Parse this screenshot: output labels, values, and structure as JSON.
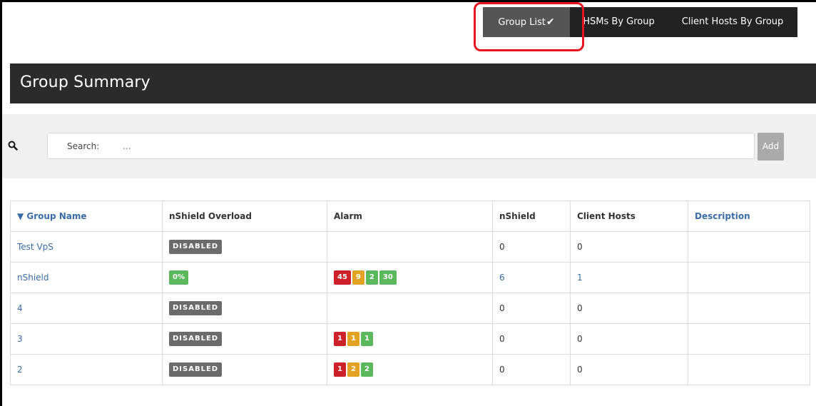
{
  "tabs": [
    {
      "label": "Group List",
      "active": true
    },
    {
      "label": "HSMs By Group"
    },
    {
      "label": "Client Hosts By Group"
    }
  ],
  "icons": {
    "active_tab_mark": "checkmark-icon",
    "search": "magnifier-icon"
  },
  "colors": {
    "header_bg": "#2b2b2b",
    "link": "#3a6da8",
    "alarm_red": "#cc2128",
    "alarm_orange": "#e1a321",
    "alarm_green": "#5cb85c",
    "disabled_badge": "#6b6b6b"
  },
  "page_title": "Group Summary",
  "search": {
    "label": "Search:",
    "placeholder": "...",
    "add_label": "Add"
  },
  "table": {
    "headers": [
      {
        "label": "▼ Group Name",
        "link": true
      },
      {
        "label": "nShield Overload"
      },
      {
        "label": "Alarm"
      },
      {
        "label": "nShield"
      },
      {
        "label": "Client Hosts"
      },
      {
        "label": "Description",
        "link": true
      }
    ],
    "rows": [
      {
        "name": "Test VpS",
        "overload": "DISABLED",
        "overload_state": "disabled",
        "alarms": [],
        "nshield": "0",
        "client_hosts": "0",
        "description": ""
      },
      {
        "name": "nShield",
        "overload": "0%",
        "overload_state": "ok",
        "alarms": [
          {
            "value": "45",
            "color": "red"
          },
          {
            "value": "9",
            "color": "orange"
          },
          {
            "value": "2",
            "color": "green"
          },
          {
            "value": "30",
            "color": "green"
          }
        ],
        "nshield": "6",
        "client_hosts": "1",
        "description": "",
        "linked_counts": true
      },
      {
        "name": "4",
        "overload": "DISABLED",
        "overload_state": "disabled",
        "alarms": [],
        "nshield": "0",
        "client_hosts": "0",
        "description": ""
      },
      {
        "name": "3",
        "overload": "DISABLED",
        "overload_state": "disabled",
        "alarms": [
          {
            "value": "1",
            "color": "red"
          },
          {
            "value": "1",
            "color": "orange"
          },
          {
            "value": "1",
            "color": "green"
          }
        ],
        "nshield": "0",
        "client_hosts": "0",
        "description": ""
      },
      {
        "name": "2",
        "overload": "DISABLED",
        "overload_state": "disabled",
        "alarms": [
          {
            "value": "1",
            "color": "red"
          },
          {
            "value": "2",
            "color": "orange"
          },
          {
            "value": "2",
            "color": "green"
          }
        ],
        "nshield": "0",
        "client_hosts": "0",
        "description": ""
      }
    ]
  }
}
